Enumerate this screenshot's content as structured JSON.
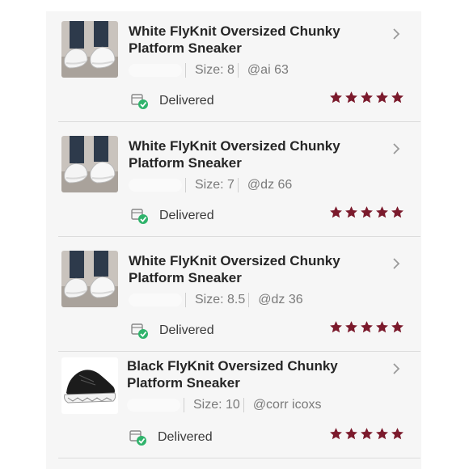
{
  "colors": {
    "star": "#7b1a2c",
    "check": "#2fb36b",
    "panel": "#f6f6f6"
  },
  "orders": [
    {
      "title": "White FlyKnit Oversized Chunky Platform Sneaker",
      "size": "Size: 8",
      "user": "@ai      63",
      "status": "Delivered",
      "rating": 5,
      "image": "white-chunky-sneaker-photo"
    },
    {
      "title": "White FlyKnit Oversized Chunky Platform Sneaker",
      "size": "Size: 7",
      "user": "@dz      66",
      "status": "Delivered",
      "rating": 5,
      "image": "white-chunky-sneaker-photo"
    },
    {
      "title": "White FlyKnit Oversized Chunky Platform Sneaker",
      "size": "Size: 8.5",
      "user": "@dz      36",
      "status": "Delivered",
      "rating": 5,
      "image": "white-chunky-sneaker-photo"
    },
    {
      "title": "Black FlyKnit Oversized Chunky Platform Sneaker",
      "size": "Size: 10",
      "user": "@corr       icoxs",
      "status": "Delivered",
      "rating": 5,
      "image": "black-chunky-sneaker-photo"
    }
  ]
}
